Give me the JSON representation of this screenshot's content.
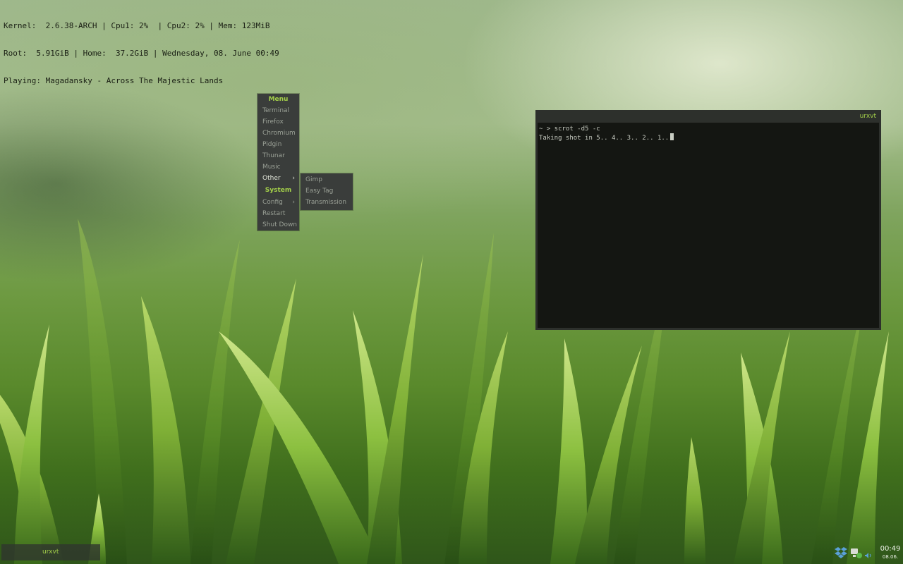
{
  "conky": {
    "line1": "Kernel:  2.6.38-ARCH | Cpu1: 2%  | Cpu2: 2% | Mem: 123MiB",
    "line2": "Root:  5.91GiB | Home:  37.2GiB | Wednesday, 08. June 00:49",
    "line3": "Playing: Magadansky - Across The Majestic Lands"
  },
  "menu": {
    "title": "Menu",
    "items": [
      "Terminal",
      "Firefox",
      "Chromium",
      "Pidgin",
      "Thunar",
      "Music",
      "Other"
    ],
    "submenu_arrow": "›",
    "section": "System",
    "system_items": [
      "Config",
      "Restart",
      "Shut Down"
    ]
  },
  "submenu": {
    "items": [
      "Gimp",
      "Easy Tag",
      "Transmission"
    ]
  },
  "terminal": {
    "title": "urxvt",
    "line1": "~ > scrot -d5 -c",
    "line2": "Taking shot in 5.. 4.. 3.. 2.. 1.."
  },
  "taskbar": {
    "task_label": "urxvt"
  },
  "tray": {
    "icons": [
      "dropbox-icon",
      "network-icon",
      "volume-icon"
    ]
  },
  "clock": {
    "time": "00:49",
    "date": "08.06."
  },
  "colors": {
    "accent": "#a4d04a",
    "menu_bg": "#3a3d3b",
    "terminal_bg": "#121410"
  }
}
